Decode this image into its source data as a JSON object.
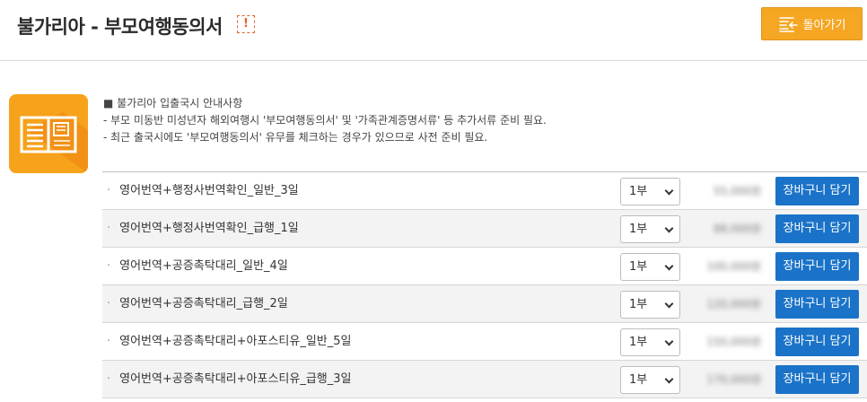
{
  "header": {
    "title": "불가리아 - 부모여행동의서",
    "alert_glyph": "!",
    "back_label": "돌아가기",
    "accent": "#f5a623"
  },
  "notice": {
    "heading": "■ 불가리아 입출국시 안내사항",
    "lines": [
      "- 부모 미동반 미성년자 해외여행시 '부모여행동의서' 및 '가족관계증명서류' 등 추가서류 준비 필요.",
      "- 최근 출국시에도 '부모여행동의서' 유무를 체크하는 경우가 있으므로 사전 준비 필요."
    ]
  },
  "products": [
    {
      "bullet": "·",
      "name": "영어번역+행정사번역확인_일반_3일",
      "qty": "1부",
      "price": "55,000원",
      "cart_label": "장바구니 담기"
    },
    {
      "bullet": "·",
      "name": "영어번역+행정사번역확인_급행_1일",
      "qty": "1부",
      "price": "88,000원",
      "cart_label": "장바구니 담기"
    },
    {
      "bullet": "·",
      "name": "영어번역+공증촉탁대리_일반_4일",
      "qty": "1부",
      "price": "100,000원",
      "cart_label": "장바구니 담기"
    },
    {
      "bullet": "·",
      "name": "영어번역+공증촉탁대리_급행_2일",
      "qty": "1부",
      "price": "120,000원",
      "cart_label": "장바구니 담기"
    },
    {
      "bullet": "·",
      "name": "영어번역+공증촉탁대리+아포스티유_일반_5일",
      "qty": "1부",
      "price": "150,000원",
      "cart_label": "장바구니 담기"
    },
    {
      "bullet": "·",
      "name": "영어번역+공증촉탁대리+아포스티유_급행_3일",
      "qty": "1부",
      "price": "170,000원",
      "cart_label": "장바구니 담기"
    }
  ],
  "colors": {
    "cart_button": "#1a73c8",
    "logo_bg": "#f7a21b",
    "alert": "#e8622b"
  },
  "icons": {
    "back": "list-arrow-left-icon",
    "logo": "open-book-document-icon",
    "select": "chevron-down-icon"
  }
}
